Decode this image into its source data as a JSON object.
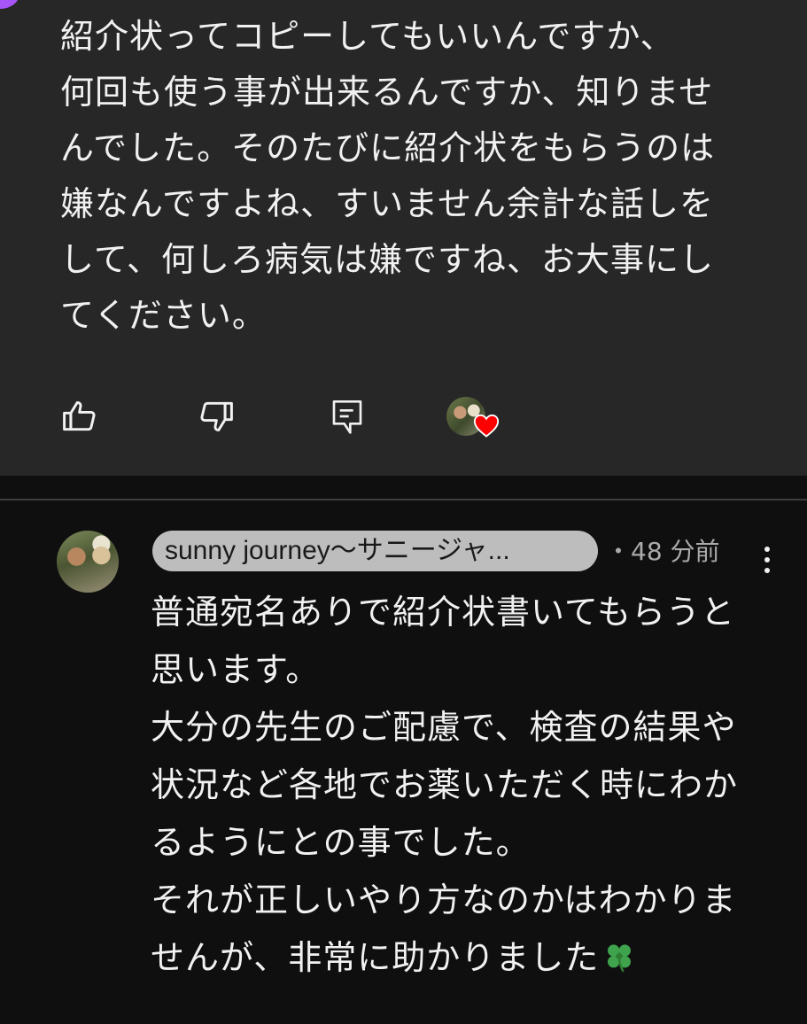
{
  "top_comment": {
    "text": "紹介状ってコピーしてもいいんですか、\n何回も使う事が出来るんですか、知りませ\nんでした。そのたびに紹介状をもらうのは\n嫌なんですよね、すいません余計な話しを\nして、何しろ病気は嫌ですね、お大事にし\nてください。"
  },
  "actions": {
    "like_icon": "thumbs-up-icon",
    "dislike_icon": "thumbs-down-icon",
    "reply_icon": "reply-icon",
    "creator_heart_icon": "heart-icon"
  },
  "reply": {
    "author": "sunny journey〜サニージャ...",
    "time": "・48 分前",
    "text": "普通宛名ありで紹介状書いてもらうと\n思います。\n大分の先生のご配慮で、検査の結果や\n状況など各地でお薬いただく時にわか\nるようにとの事でした。\nそれが正しいやり方なのかはわかりま\nせんが、非常に助かりました",
    "trailing_emoji": "four-leaf-clover-icon"
  },
  "colors": {
    "top_background": "#272727",
    "page_background": "#0f0f0f",
    "author_chip": "#bdbdbd",
    "heart": "#ff0000"
  }
}
